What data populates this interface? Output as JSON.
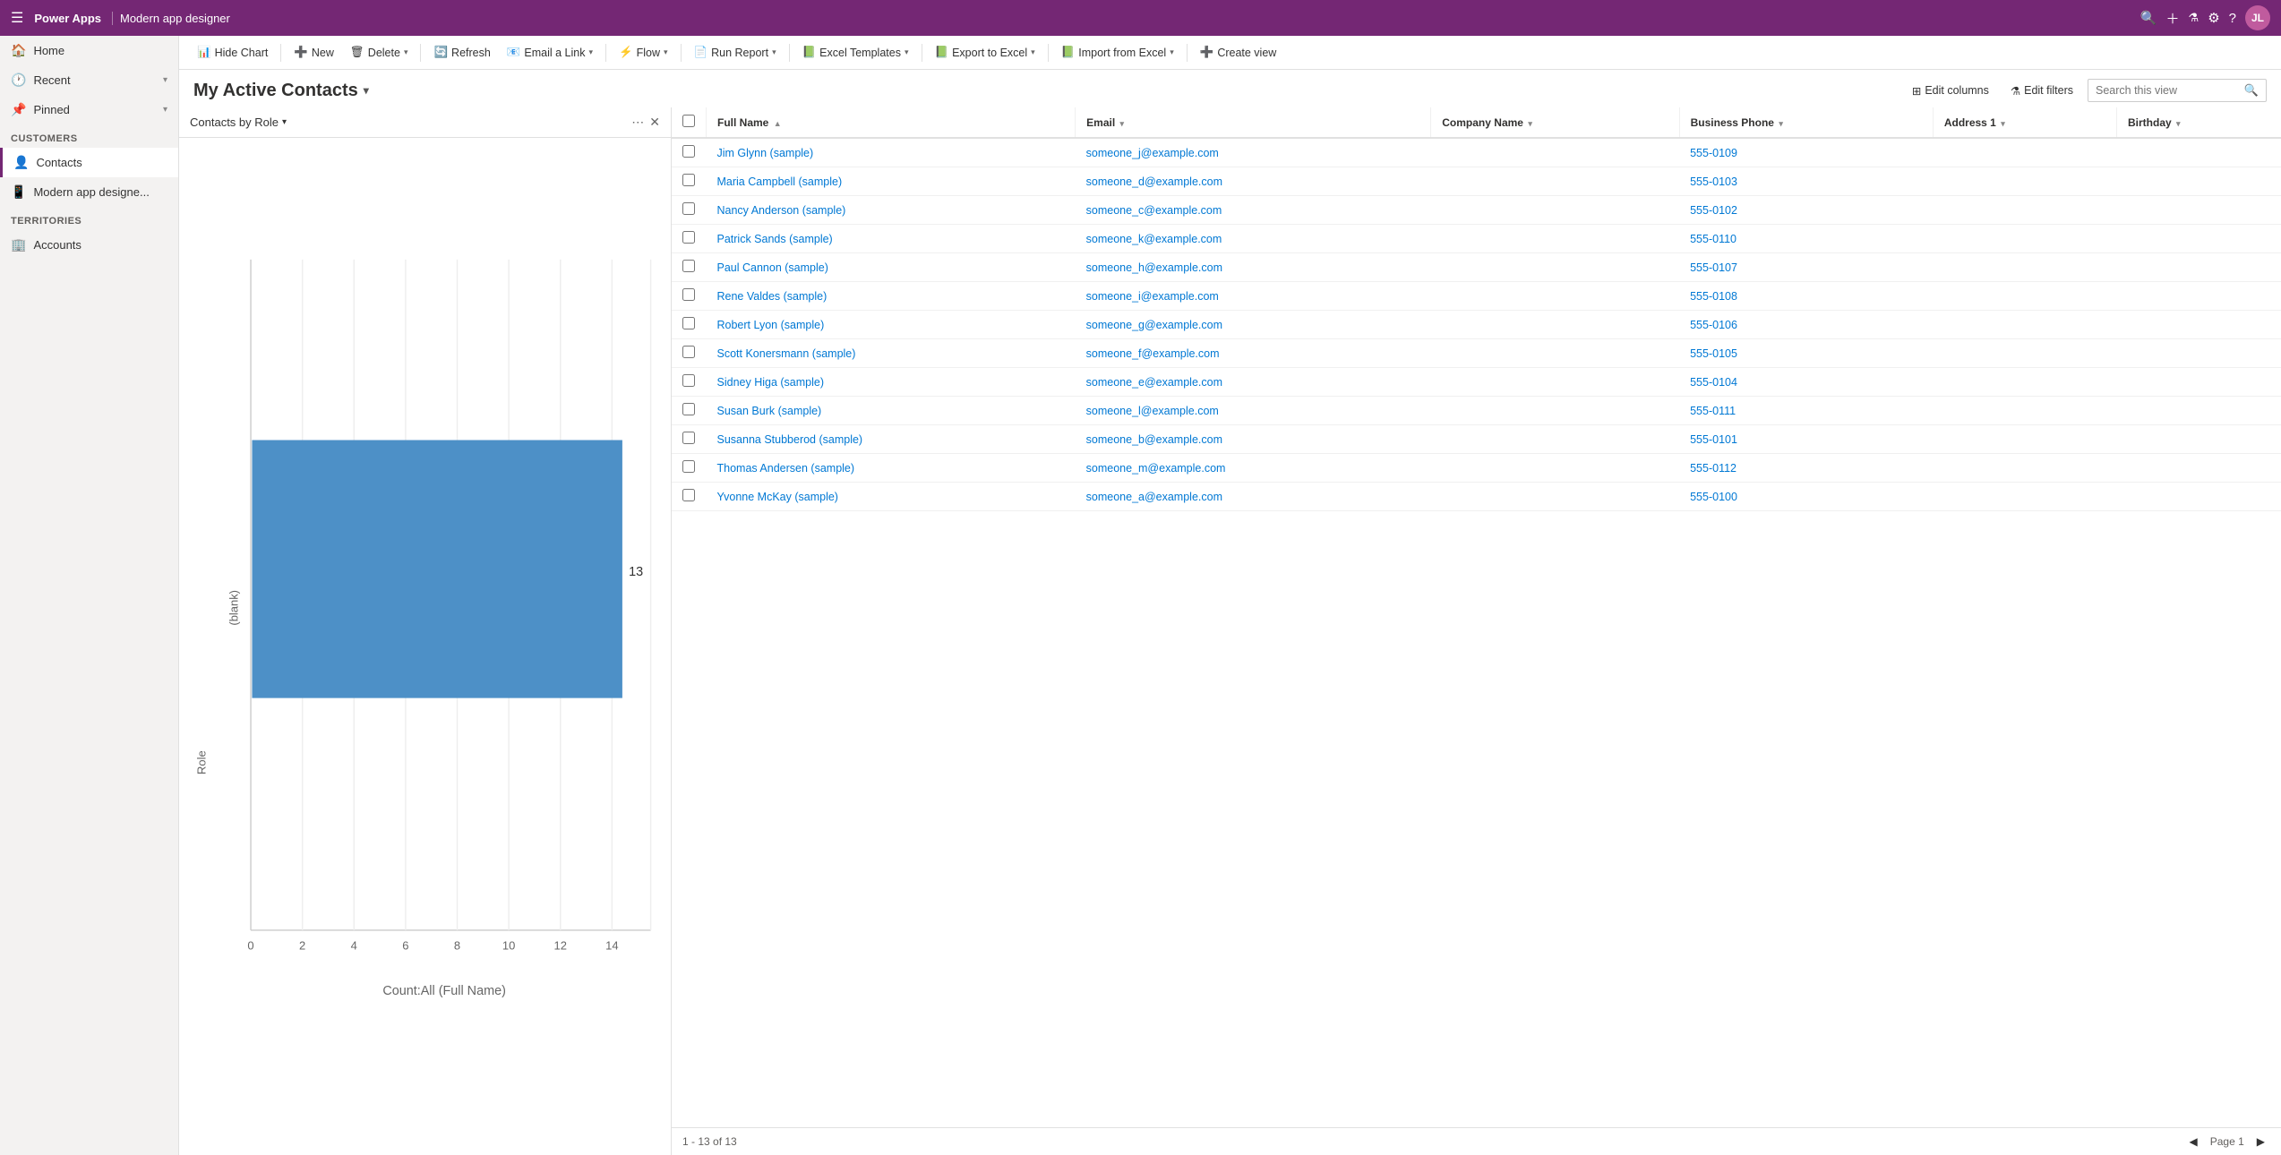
{
  "topbar": {
    "brand": "Power Apps",
    "appname": "Modern app designer",
    "hamburger": "☰",
    "search_icon": "🔍",
    "plus_icon": "+",
    "filter_icon": "⚗",
    "settings_icon": "⚙",
    "help_icon": "?",
    "avatar_text": "JL",
    "avatar_color": "#c05b9e"
  },
  "sidebar": {
    "home_label": "Home",
    "recent_label": "Recent",
    "pinned_label": "Pinned",
    "customers_section": "Customers",
    "contacts_label": "Contacts",
    "modern_app_label": "Modern app designe...",
    "territories_section": "Territories",
    "accounts_label": "Accounts"
  },
  "toolbar": {
    "hide_chart": "Hide Chart",
    "new": "New",
    "delete": "Delete",
    "refresh": "Refresh",
    "email_link": "Email a Link",
    "flow": "Flow",
    "run_report": "Run Report",
    "excel_templates": "Excel Templates",
    "export_to_excel": "Export to Excel",
    "import_from_excel": "Import from Excel",
    "create_view": "Create view"
  },
  "view": {
    "title": "My Active Contacts",
    "edit_columns": "Edit columns",
    "edit_filters": "Edit filters",
    "search_placeholder": "Search this view"
  },
  "chart": {
    "title": "Contacts by Role",
    "bar_label": "(blank)",
    "bar_value": 13,
    "x_axis_label": "Count:All (Full Name)",
    "y_axis_label": "Role",
    "bar_color": "#4d90c7",
    "x_ticks": [
      "0",
      "2",
      "4",
      "6",
      "8",
      "10",
      "12",
      "14"
    ]
  },
  "table": {
    "columns": [
      {
        "key": "fullName",
        "label": "Full Name",
        "sort": true
      },
      {
        "key": "email",
        "label": "Email",
        "sort": true
      },
      {
        "key": "companyName",
        "label": "Company Name",
        "sort": true
      },
      {
        "key": "businessPhone",
        "label": "Business Phone",
        "sort": true
      },
      {
        "key": "address1",
        "label": "Address 1",
        "sort": true
      },
      {
        "key": "birthday",
        "label": "Birthday",
        "sort": true
      }
    ],
    "rows": [
      {
        "fullName": "Jim Glynn (sample)",
        "email": "someone_j@example.com",
        "companyName": "",
        "businessPhone": "555-0109",
        "address1": "",
        "birthday": ""
      },
      {
        "fullName": "Maria Campbell (sample)",
        "email": "someone_d@example.com",
        "companyName": "",
        "businessPhone": "555-0103",
        "address1": "",
        "birthday": ""
      },
      {
        "fullName": "Nancy Anderson (sample)",
        "email": "someone_c@example.com",
        "companyName": "",
        "businessPhone": "555-0102",
        "address1": "",
        "birthday": ""
      },
      {
        "fullName": "Patrick Sands (sample)",
        "email": "someone_k@example.com",
        "companyName": "",
        "businessPhone": "555-0110",
        "address1": "",
        "birthday": ""
      },
      {
        "fullName": "Paul Cannon (sample)",
        "email": "someone_h@example.com",
        "companyName": "",
        "businessPhone": "555-0107",
        "address1": "",
        "birthday": ""
      },
      {
        "fullName": "Rene Valdes (sample)",
        "email": "someone_i@example.com",
        "companyName": "",
        "businessPhone": "555-0108",
        "address1": "",
        "birthday": ""
      },
      {
        "fullName": "Robert Lyon (sample)",
        "email": "someone_g@example.com",
        "companyName": "",
        "businessPhone": "555-0106",
        "address1": "",
        "birthday": ""
      },
      {
        "fullName": "Scott Konersmann (sample)",
        "email": "someone_f@example.com",
        "companyName": "",
        "businessPhone": "555-0105",
        "address1": "",
        "birthday": ""
      },
      {
        "fullName": "Sidney Higa (sample)",
        "email": "someone_e@example.com",
        "companyName": "",
        "businessPhone": "555-0104",
        "address1": "",
        "birthday": ""
      },
      {
        "fullName": "Susan Burk (sample)",
        "email": "someone_l@example.com",
        "companyName": "",
        "businessPhone": "555-0111",
        "address1": "",
        "birthday": ""
      },
      {
        "fullName": "Susanna Stubberod (sample)",
        "email": "someone_b@example.com",
        "companyName": "",
        "businessPhone": "555-0101",
        "address1": "",
        "birthday": ""
      },
      {
        "fullName": "Thomas Andersen (sample)",
        "email": "someone_m@example.com",
        "companyName": "",
        "businessPhone": "555-0112",
        "address1": "",
        "birthday": ""
      },
      {
        "fullName": "Yvonne McKay (sample)",
        "email": "someone_a@example.com",
        "companyName": "",
        "businessPhone": "555-0100",
        "address1": "",
        "birthday": ""
      }
    ],
    "footer_text": "1 - 13 of 13",
    "page_label": "Page 1"
  }
}
